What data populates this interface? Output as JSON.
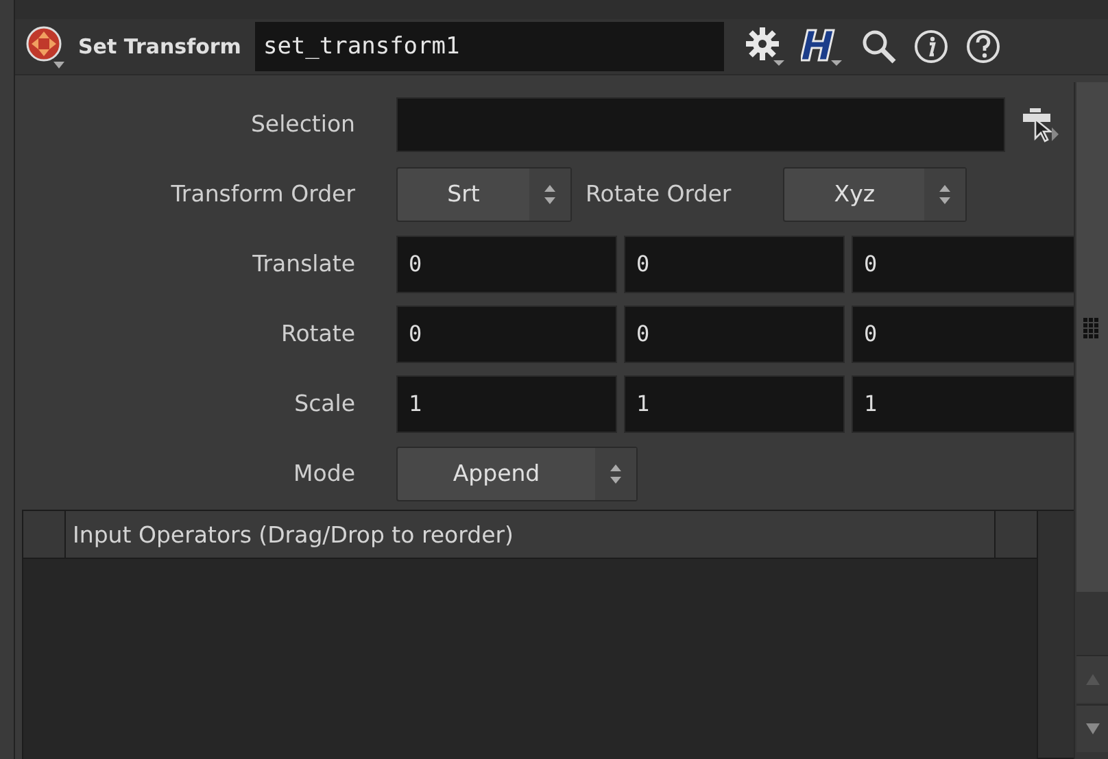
{
  "header": {
    "node_type": "Set Transform",
    "node_name": "set_transform1"
  },
  "params": [
    {
      "kind": "field",
      "label": "Selection"
    },
    {
      "kind": "menus",
      "items": [
        {
          "label": "Transform Order",
          "value": "Srt"
        },
        {
          "label": "Rotate Order",
          "value": "Xyz"
        }
      ]
    },
    {
      "kind": "vector",
      "label": "Translate",
      "values": [
        "0",
        "0",
        "0"
      ]
    },
    {
      "kind": "vector",
      "label": "Rotate",
      "values": [
        "0",
        "0",
        "0"
      ]
    },
    {
      "kind": "vector",
      "label": "Scale",
      "values": [
        "1",
        "1",
        "1"
      ]
    },
    {
      "kind": "menu",
      "label": "Mode",
      "value": "Append"
    }
  ],
  "input_list": {
    "header": "Input Operators (Drag/Drop to reorder)"
  }
}
